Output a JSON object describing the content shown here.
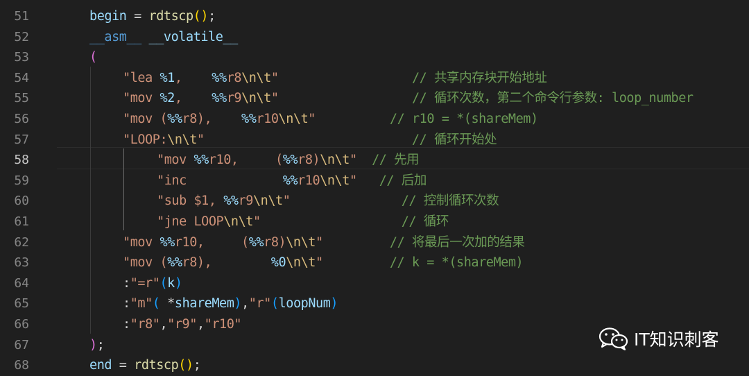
{
  "editor": {
    "line_numbers": [
      "51",
      "52",
      "53",
      "54",
      "55",
      "56",
      "57",
      "58",
      "59",
      "60",
      "61",
      "62",
      "63",
      "64",
      "65",
      "66",
      "67",
      "68"
    ],
    "active_line": "58",
    "lines": [
      [
        {
          "t": "begin",
          "c": "var"
        },
        {
          "t": " = ",
          "c": "plain"
        },
        {
          "t": "rdtscp",
          "c": "fn"
        },
        {
          "t": "()",
          "c": "bracket"
        },
        {
          "t": ";",
          "c": "plain"
        }
      ],
      [
        {
          "t": "__asm__",
          "c": "kw"
        },
        {
          "t": " ",
          "c": "plain"
        },
        {
          "t": "__volatile__",
          "c": "var"
        }
      ],
      [
        {
          "t": "(",
          "c": "paren"
        }
      ],
      [
        {
          "t": "\"lea ",
          "c": "str"
        },
        {
          "t": "%1",
          "c": "fmt"
        },
        {
          "t": ",    ",
          "c": "str"
        },
        {
          "t": "%%",
          "c": "fmt"
        },
        {
          "t": "r8",
          "c": "str"
        },
        {
          "t": "\\n\\t",
          "c": "esc"
        },
        {
          "t": "\"",
          "c": "str"
        },
        {
          "t": "                  ",
          "c": "plain"
        },
        {
          "t": "// 共享内存块开始地址",
          "c": "cmt"
        }
      ],
      [
        {
          "t": "\"mov ",
          "c": "str"
        },
        {
          "t": "%2",
          "c": "fmt"
        },
        {
          "t": ",    ",
          "c": "str"
        },
        {
          "t": "%%",
          "c": "fmt"
        },
        {
          "t": "r9",
          "c": "str"
        },
        {
          "t": "\\n\\t",
          "c": "esc"
        },
        {
          "t": "\"",
          "c": "str"
        },
        {
          "t": "                  ",
          "c": "plain"
        },
        {
          "t": "// 循环次数，第二个命令行参数: loop_number",
          "c": "cmt"
        }
      ],
      [
        {
          "t": "\"mov (",
          "c": "str"
        },
        {
          "t": "%%",
          "c": "fmt"
        },
        {
          "t": "r8),    ",
          "c": "str"
        },
        {
          "t": "%%",
          "c": "fmt"
        },
        {
          "t": "r10",
          "c": "str"
        },
        {
          "t": "\\n\\t",
          "c": "esc"
        },
        {
          "t": "\"",
          "c": "str"
        },
        {
          "t": "          ",
          "c": "plain"
        },
        {
          "t": "// r10 = *(shareMem)",
          "c": "cmt"
        }
      ],
      [
        {
          "t": "\"LOOP:",
          "c": "str"
        },
        {
          "t": "\\n\\t",
          "c": "esc"
        },
        {
          "t": "\"",
          "c": "str"
        },
        {
          "t": "                            ",
          "c": "plain"
        },
        {
          "t": "// 循环开始处",
          "c": "cmt"
        }
      ],
      [
        {
          "t": "\"mov ",
          "c": "str"
        },
        {
          "t": "%%",
          "c": "fmt"
        },
        {
          "t": "r10,     (",
          "c": "str"
        },
        {
          "t": "%%",
          "c": "fmt"
        },
        {
          "t": "r8)",
          "c": "str"
        },
        {
          "t": "\\n\\t",
          "c": "esc"
        },
        {
          "t": "\"",
          "c": "str"
        },
        {
          "t": "  ",
          "c": "plain"
        },
        {
          "t": "// 先用",
          "c": "cmt"
        }
      ],
      [
        {
          "t": "\"inc             ",
          "c": "str"
        },
        {
          "t": "%%",
          "c": "fmt"
        },
        {
          "t": "r10",
          "c": "str"
        },
        {
          "t": "\\n\\t",
          "c": "esc"
        },
        {
          "t": "\"",
          "c": "str"
        },
        {
          "t": "   ",
          "c": "plain"
        },
        {
          "t": "// 后加",
          "c": "cmt"
        }
      ],
      [
        {
          "t": "\"sub $1, ",
          "c": "str"
        },
        {
          "t": "%%",
          "c": "fmt"
        },
        {
          "t": "r9",
          "c": "str"
        },
        {
          "t": "\\n\\t",
          "c": "esc"
        },
        {
          "t": "\"",
          "c": "str"
        },
        {
          "t": "               ",
          "c": "plain"
        },
        {
          "t": "// 控制循环次数",
          "c": "cmt"
        }
      ],
      [
        {
          "t": "\"jne LOOP",
          "c": "str"
        },
        {
          "t": "\\n\\t",
          "c": "esc"
        },
        {
          "t": "\"",
          "c": "str"
        },
        {
          "t": "                   ",
          "c": "plain"
        },
        {
          "t": "// 循环",
          "c": "cmt"
        }
      ],
      [
        {
          "t": "\"mov ",
          "c": "str"
        },
        {
          "t": "%%",
          "c": "fmt"
        },
        {
          "t": "r10,     (",
          "c": "str"
        },
        {
          "t": "%%",
          "c": "fmt"
        },
        {
          "t": "r8)",
          "c": "str"
        },
        {
          "t": "\\n\\t",
          "c": "esc"
        },
        {
          "t": "\"",
          "c": "str"
        },
        {
          "t": "         ",
          "c": "plain"
        },
        {
          "t": "// 将最后一次加的结果",
          "c": "cmt"
        }
      ],
      [
        {
          "t": "\"mov (",
          "c": "str"
        },
        {
          "t": "%%",
          "c": "fmt"
        },
        {
          "t": "r8),        ",
          "c": "str"
        },
        {
          "t": "%0",
          "c": "fmt"
        },
        {
          "t": "\\n\\t",
          "c": "esc"
        },
        {
          "t": "\"",
          "c": "str"
        },
        {
          "t": "         ",
          "c": "plain"
        },
        {
          "t": "// k = *(shareMem)",
          "c": "cmt"
        }
      ],
      [
        {
          "t": ":",
          "c": "plain"
        },
        {
          "t": "\"=r\"",
          "c": "str"
        },
        {
          "t": "(",
          "c": "blue"
        },
        {
          "t": "k",
          "c": "var"
        },
        {
          "t": ")",
          "c": "blue"
        }
      ],
      [
        {
          "t": ":",
          "c": "plain"
        },
        {
          "t": "\"m\"",
          "c": "str"
        },
        {
          "t": "(",
          "c": "blue"
        },
        {
          "t": " *",
          "c": "plain"
        },
        {
          "t": "shareMem",
          "c": "var"
        },
        {
          "t": ")",
          "c": "blue"
        },
        {
          "t": ",",
          "c": "plain"
        },
        {
          "t": "\"r\"",
          "c": "str"
        },
        {
          "t": "(",
          "c": "blue"
        },
        {
          "t": "loopNum",
          "c": "var"
        },
        {
          "t": ")",
          "c": "blue"
        }
      ],
      [
        {
          "t": ":",
          "c": "plain"
        },
        {
          "t": "\"r8\"",
          "c": "str"
        },
        {
          "t": ",",
          "c": "plain"
        },
        {
          "t": "\"r9\"",
          "c": "str"
        },
        {
          "t": ",",
          "c": "plain"
        },
        {
          "t": "\"r10\"",
          "c": "str"
        }
      ],
      [
        {
          "t": ")",
          "c": "paren"
        },
        {
          "t": ";",
          "c": "plain"
        }
      ],
      [
        {
          "t": "end",
          "c": "var"
        },
        {
          "t": " = ",
          "c": "plain"
        },
        {
          "t": "rdtscp",
          "c": "fn"
        },
        {
          "t": "()",
          "c": "bracket"
        },
        {
          "t": ";",
          "c": "plain"
        }
      ]
    ]
  },
  "watermark": {
    "text": "IT知识刺客",
    "icon": "wechat-icon"
  }
}
